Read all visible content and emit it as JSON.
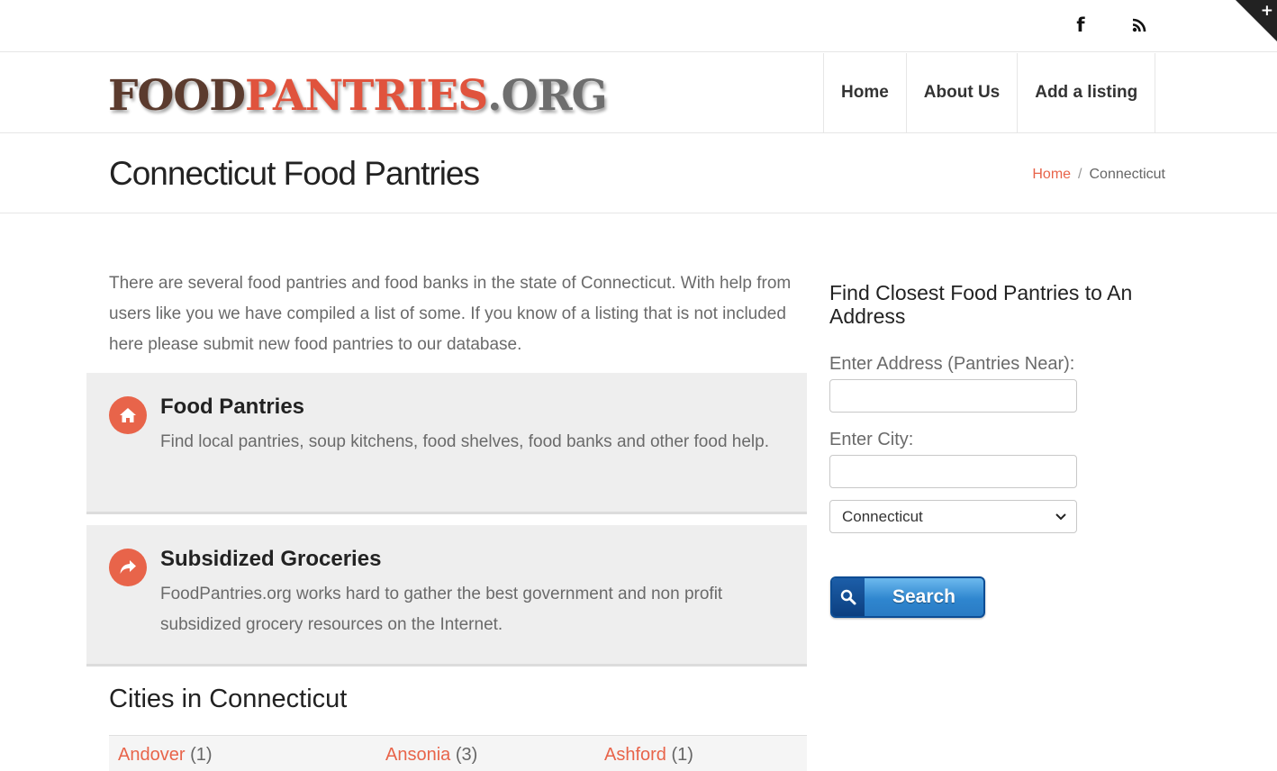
{
  "topbar": {
    "social": [
      {
        "name": "facebook-icon",
        "glyph": "f"
      },
      {
        "name": "rss-icon"
      }
    ],
    "corner_glyph": "+"
  },
  "header": {
    "logo": {
      "part1": "FOOD",
      "part2": "PANTRIES",
      "part3": ".ORG"
    },
    "nav": [
      {
        "label": "Home"
      },
      {
        "label": "About Us"
      },
      {
        "label": "Add a listing"
      }
    ]
  },
  "titlebar": {
    "title": "Connecticut Food Pantries",
    "breadcrumb": {
      "home": "Home",
      "separator": "/",
      "current": "Connecticut"
    }
  },
  "main": {
    "intro": "There are several food pantries and food banks in the state of Connecticut. With help from users like you we have compiled a list of some. If you know of a listing that is not included here please submit new food pantries to our database.",
    "features": [
      {
        "title": "Food Pantries",
        "description": "Find local pantries, soup kitchens, food shelves, food banks and other food help.",
        "icon": "home-icon"
      },
      {
        "title": "Subsidized Groceries",
        "description": "FoodPantries.org works hard to gather the best government and non profit subsidized grocery resources on the Internet.",
        "icon": "share-arrow-icon"
      }
    ],
    "cities_title": "Cities in Connecticut",
    "cities": [
      {
        "name": "Andover",
        "count": "(1)"
      },
      {
        "name": "Ansonia",
        "count": "(3)"
      },
      {
        "name": "Ashford",
        "count": "(1)"
      }
    ]
  },
  "sidebar": {
    "title": "Find Closest Food Pantries to An Address",
    "address_label": "Enter Address (Pantries Near):",
    "address_value": "",
    "city_label": "Enter City:",
    "city_value": "",
    "state_selected": "Connecticut",
    "search_label": "Search"
  },
  "colors": {
    "accent": "#e8644a",
    "feature_bg": "#eeeeee",
    "button_blue": "#2f86cf"
  }
}
